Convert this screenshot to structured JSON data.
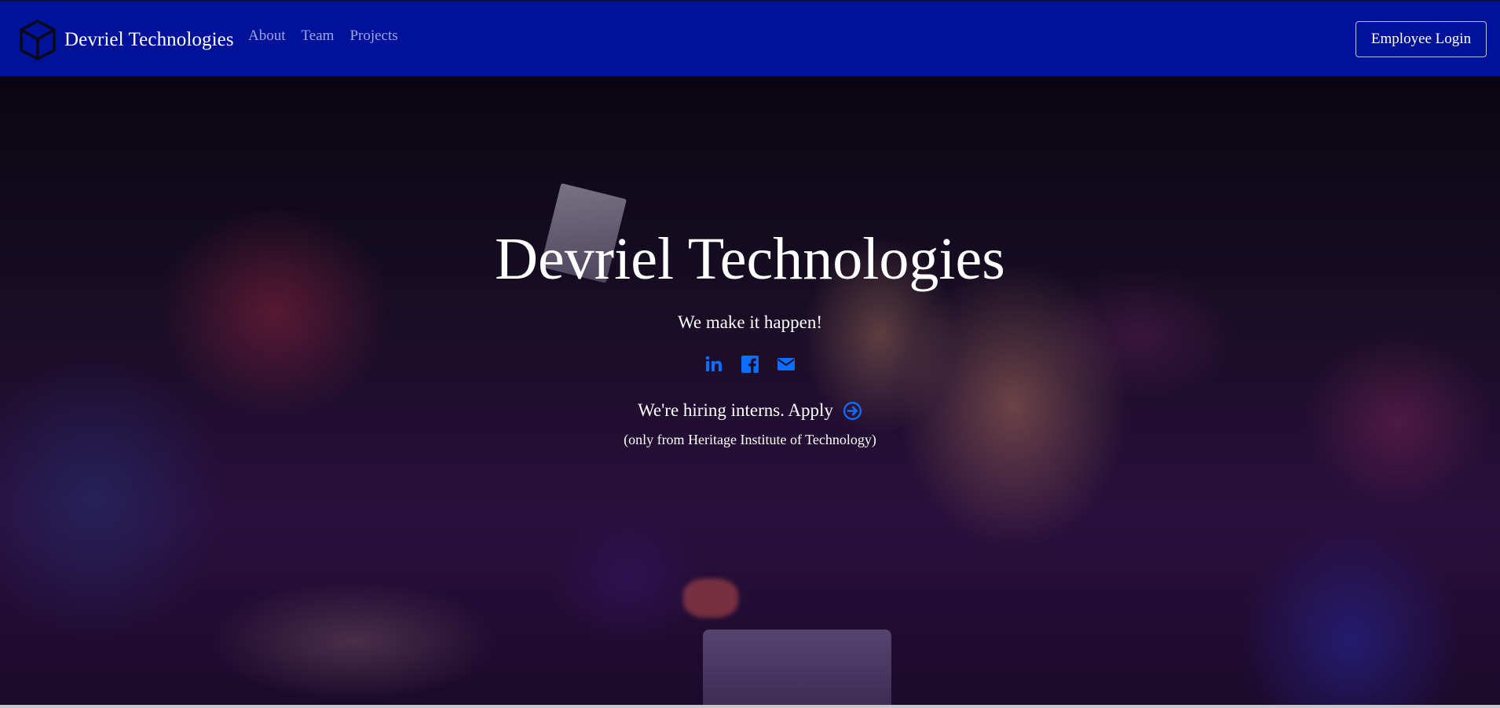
{
  "navbar": {
    "brand": {
      "name": "Devriel Technologies",
      "icon": "cube-icon"
    },
    "links": [
      {
        "label": "About"
      },
      {
        "label": "Team"
      },
      {
        "label": "Projects"
      }
    ],
    "login_button": "Employee Login",
    "colors": {
      "background": "#00129a",
      "link": "#9aa6e6"
    }
  },
  "hero": {
    "title": "Devriel Technologies",
    "subtitle": "We make it happen!",
    "social": [
      {
        "icon": "linkedin-icon"
      },
      {
        "icon": "facebook-icon"
      },
      {
        "icon": "email-icon"
      }
    ],
    "hiring_text": "We're hiring interns. Apply",
    "apply_icon": "arrow-circle-right-icon",
    "note": "(only from Heritage Institute of Technology)",
    "accent_color": "#0d6efd"
  }
}
